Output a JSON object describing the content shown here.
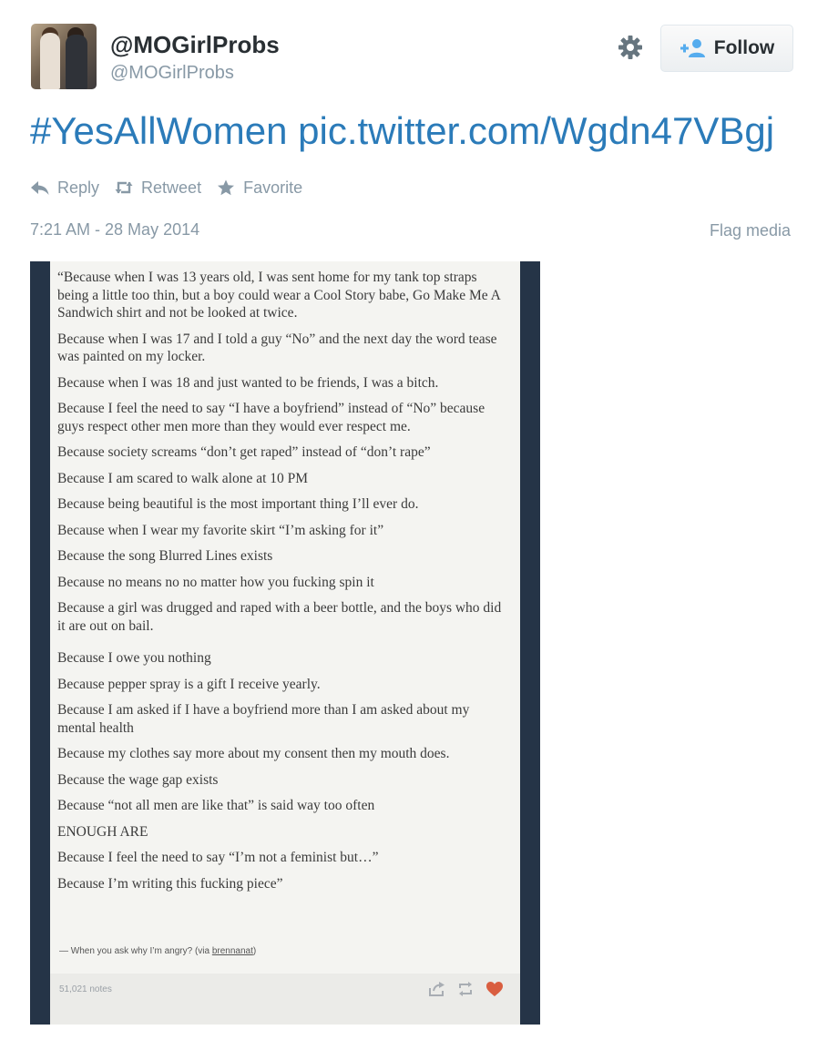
{
  "header": {
    "display_name": "@MOGirlProbs",
    "screen_name": "@MOGirlProbs",
    "follow_label": "Follow"
  },
  "tweet": {
    "text": "#YesAllWomen pic.twitter.com/Wgdn47VBgj",
    "actions": {
      "reply": "Reply",
      "retweet": "Retweet",
      "favorite": "Favorite"
    },
    "timestamp": "7:21 AM - 28 May 2014",
    "flag_media": "Flag media"
  },
  "media": {
    "lines": [
      "“Because when I was 13 years old, I was sent home for my tank top straps being a little too thin, but a boy could wear a Cool Story babe, Go Make Me A Sandwich shirt and not be looked at twice.",
      "Because when I was 17 and I told a guy “No” and the next day the word tease was painted on my locker.",
      "Because when I was 18 and just wanted to be friends, I was a bitch.",
      "Because I feel the need to say “I have a boyfriend” instead of “No” because guys respect other men more than they would ever respect me.",
      "Because society screams “don’t get raped” instead of “don’t rape”",
      "Because I am scared to walk alone at 10 PM",
      "Because being beautiful is the most important thing I’ll ever do.",
      "Because when I wear my favorite skirt “I’m asking for it”",
      "Because the song Blurred Lines exists",
      "Because no means no no matter how you fucking spin it",
      "Because a girl was drugged and raped with a beer bottle, and the boys who did it are out on bail.",
      "Because I owe you nothing",
      "Because pepper spray is a gift I receive yearly.",
      "Because I am asked if I have a boyfriend more than I am asked about my mental health",
      "Because my clothes say more about my consent then my mouth does.",
      "Because the wage gap exists",
      "Because “not all men are like that” is said way too often",
      "ENOUGH ARE",
      "Because I feel the need to say “I’m not a feminist but…”",
      "Because I’m writing this fucking piece”"
    ],
    "attribution_prefix": "— When you ask why I’m angry? (via ",
    "attribution_link": "brennanat",
    "attribution_suffix": ")",
    "notes": "51,021 notes"
  }
}
